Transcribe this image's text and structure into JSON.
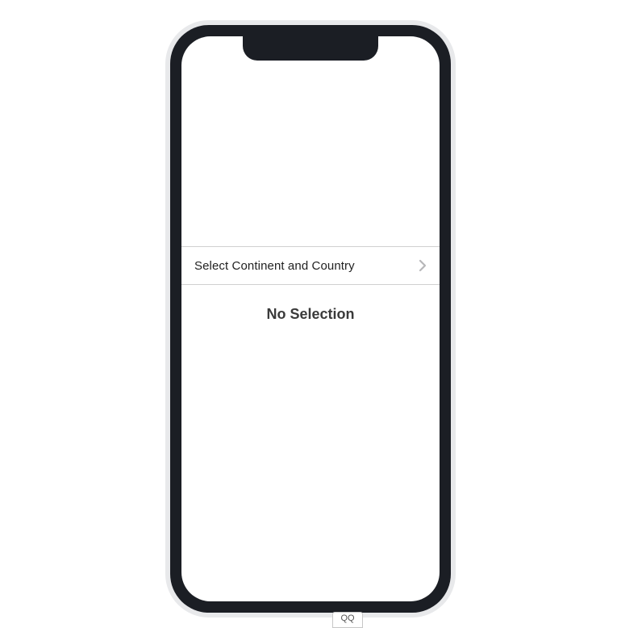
{
  "picker": {
    "row_label": "Select Continent and Country"
  },
  "result": {
    "status_text": "No Selection"
  },
  "footer": {
    "tab_label": "QQ"
  }
}
